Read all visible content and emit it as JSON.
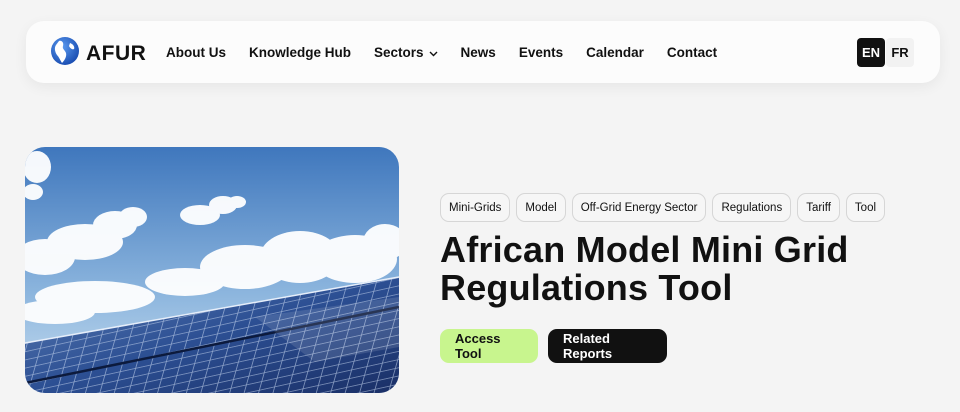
{
  "brand": {
    "name": "AFUR",
    "logo_icon": "globe-icon",
    "accent": "#c8f58e"
  },
  "nav": {
    "items": [
      {
        "label": "About Us"
      },
      {
        "label": "Knowledge Hub"
      },
      {
        "label": "Sectors",
        "has_dropdown": true
      },
      {
        "label": "News"
      },
      {
        "label": "Events"
      },
      {
        "label": "Calendar"
      },
      {
        "label": "Contact"
      }
    ],
    "languages": [
      {
        "label": "EN",
        "active": true
      },
      {
        "label": "FR",
        "active": false
      }
    ]
  },
  "hero": {
    "image_icon": "solar-panels-image",
    "tags": [
      "Mini-Grids",
      "Model",
      "Off-Grid Energy Sector",
      "Regulations",
      "Tariff",
      "Tool"
    ],
    "title_line1": "African Model Mini Grid",
    "title_line2": "Regulations Tool",
    "primary_button": "Access Tool",
    "secondary_button": "Related Reports"
  }
}
